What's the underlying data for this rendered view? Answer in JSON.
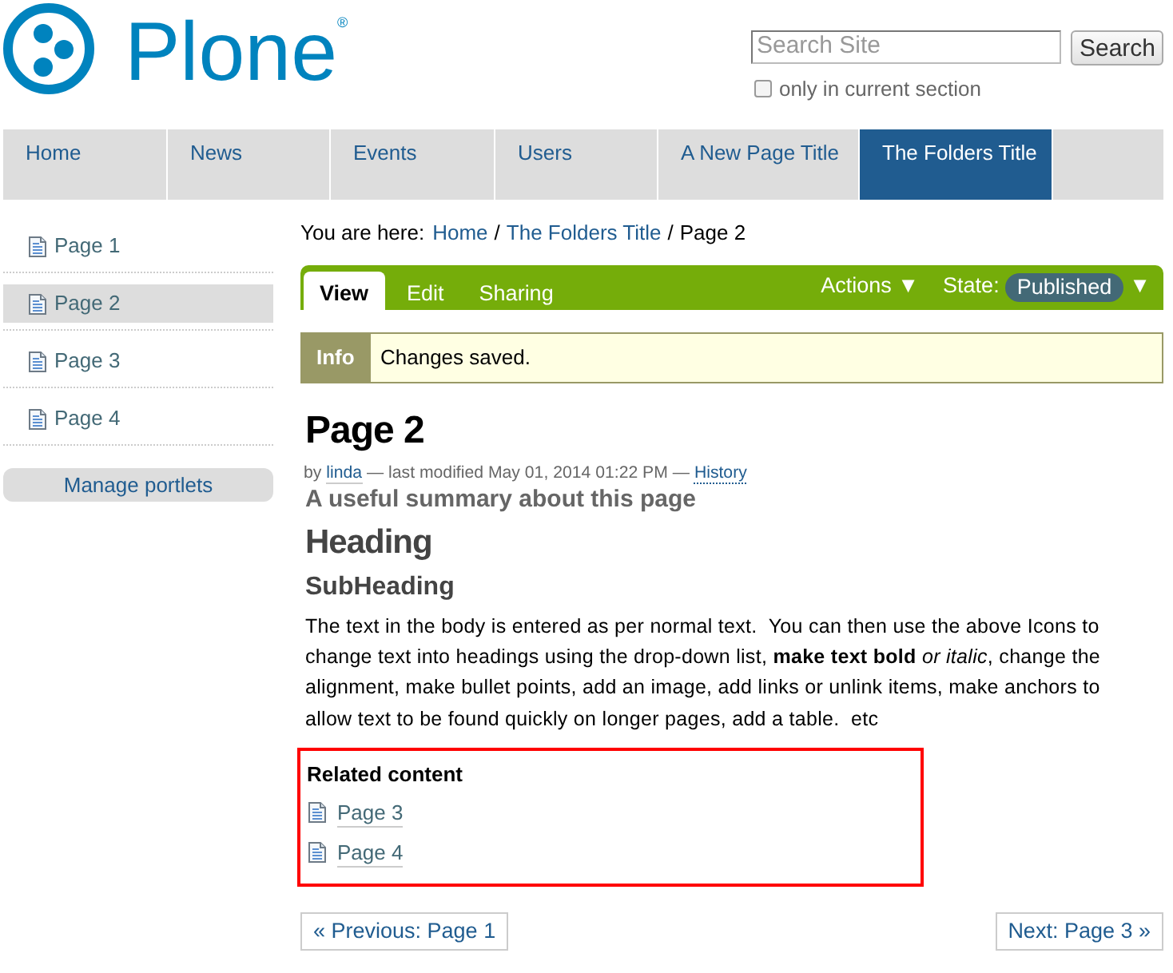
{
  "logo": {
    "wordmark": "Plone$^{®}$"
  },
  "search": {
    "placeholder": "Search Site",
    "button": "Search",
    "current_section_only": {
      "label": "only in current section",
      "checked": false
    }
  },
  "nav_tabs": [
    {
      "label": "Home",
      "selected": false
    },
    {
      "label": "News",
      "selected": false
    },
    {
      "label": "Events",
      "selected": false
    },
    {
      "label": "Users",
      "selected": false
    },
    {
      "label": "A New Page Title",
      "selected": false
    },
    {
      "label": "The Folders Title",
      "selected": true
    }
  ],
  "sidebar": {
    "items": [
      {
        "label": "Page 1",
        "selected": false
      },
      {
        "label": "Page 2",
        "selected": true
      },
      {
        "label": "Page 3",
        "selected": false
      },
      {
        "label": "Page 4",
        "selected": false
      }
    ],
    "manage_button": "Manage portlets"
  },
  "breadcrumb": {
    "label": "You are here:",
    "items": [
      {
        "label": "Home",
        "kind": "link"
      },
      {
        "label": "The Folders Title",
        "kind": "link",
        "separator": "/"
      },
      {
        "label": "Page 2",
        "kind": "current",
        "separator": "/"
      }
    ]
  },
  "content_toolbar": {
    "tabs": [
      {
        "label": "View",
        "selected": true
      },
      {
        "label": "Edit",
        "selected": false
      },
      {
        "label": "Sharing",
        "selected": false
      }
    ],
    "actions": {
      "label": "Actions",
      "caret": "▼"
    },
    "state": {
      "label": "State:",
      "value": "Published",
      "caret": "▼"
    }
  },
  "status_message": {
    "type": "Info",
    "text": "Changes saved."
  },
  "document": {
    "title": "Page 2",
    "byline": {
      "prefix": "by",
      "author": "linda",
      "modified": "— last modified May 01, 2014 01:22 PM —",
      "history": "History"
    },
    "description": "A useful summary about this page",
    "heading": "Heading",
    "subheading": "SubHeading",
    "body": "The text in the body is entered as per normal text.  You can then use the above Icons to change text into headings using the drop-down list, **make text bold** *or italic*, change the alignment, make bullet points, add an image, add links or unlink items, make anchors to allow text to be found quickly on longer pages, add a table.  etc"
  },
  "related": {
    "title": "Related content",
    "items": [
      {
        "label": "Page 3"
      },
      {
        "label": "Page 4"
      }
    ]
  },
  "pager": {
    "previous": "« Previous: Page 1",
    "next": "Next: Page 3 »"
  }
}
